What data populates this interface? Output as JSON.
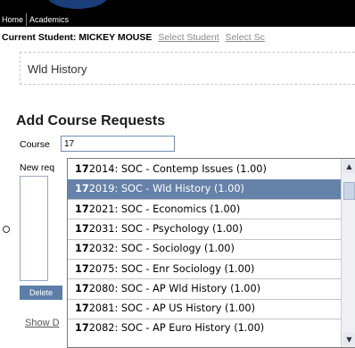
{
  "nav": {
    "items": [
      "Home",
      "Academics"
    ]
  },
  "student": {
    "label": "Current Student: MICKEY MOUSE",
    "select_student_link": "Select Student",
    "select_school_link": "Select Sc"
  },
  "course_box": {
    "text": "Wld History"
  },
  "form": {
    "title": "Add Course Requests",
    "course_label": "Course",
    "course_value": "17",
    "new_requests_label": "New req",
    "delete_button": "Delete",
    "show_link": "Show D"
  },
  "autocomplete": {
    "typed": "17",
    "items": [
      {
        "prefix": "17",
        "suffix": "2014: SOC - Contemp Issues (1.00)",
        "selected": false
      },
      {
        "prefix": "17",
        "suffix": "2019: SOC - Wld History (1.00)",
        "selected": true
      },
      {
        "prefix": "17",
        "suffix": "2021: SOC - Economics (1.00)",
        "selected": false
      },
      {
        "prefix": "17",
        "suffix": "2031: SOC - Psychology (1.00)",
        "selected": false
      },
      {
        "prefix": "17",
        "suffix": "2032: SOC - Sociology (1.00)",
        "selected": false
      },
      {
        "prefix": "17",
        "suffix": "2075: SOC - Enr Sociology (1.00)",
        "selected": false
      },
      {
        "prefix": "17",
        "suffix": "2080: SOC - AP Wld History (1.00)",
        "selected": false
      },
      {
        "prefix": "17",
        "suffix": "2081: SOC - AP US History (1.00)",
        "selected": false
      },
      {
        "prefix": "17",
        "suffix": "2082: SOC - AP Euro History (1.00)",
        "selected": false
      }
    ]
  },
  "icons": {
    "scroll_up": "chevron-up-icon",
    "scroll_down": "chevron-down-icon"
  },
  "colors": {
    "nav_bg": "#000000",
    "selected_bg": "#6582a8",
    "delete_bg": "#5d7ea8",
    "logo": "#1b3d7a"
  }
}
